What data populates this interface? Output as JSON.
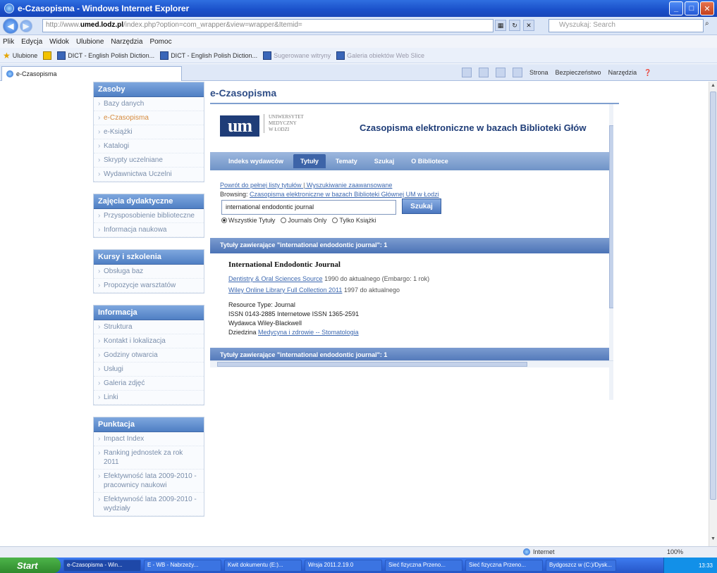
{
  "window": {
    "title": "e-Czasopisma - Windows Internet Explorer"
  },
  "address": {
    "url_prefix": "http://www.",
    "url_domain": "umed.lodz.pl",
    "url_rest": "/index.php?option=com_wrapper&view=wrapper&Itemid=",
    "search_placeholder": "Wyszukaj: Search"
  },
  "menu": [
    "Plik",
    "Edycja",
    "Widok",
    "Ulubione",
    "Narzędzia",
    "Pomoc"
  ],
  "favorites": {
    "label": "Ulubione",
    "items": [
      "DICT - English Polish Diction...",
      "DICT - English Polish Diction...",
      "Sugerowane witryny",
      "Galeria obiektów Web Slice"
    ]
  },
  "tab": {
    "label": "e-Czasopisma"
  },
  "commands": [
    "Strona",
    "Bezpieczeństwo",
    "Narzędzia"
  ],
  "sidebar": {
    "boxes": [
      {
        "title": "Zasoby",
        "items": [
          {
            "label": "Bazy danych",
            "active": false
          },
          {
            "label": "e-Czasopisma",
            "active": true
          },
          {
            "label": "e-Książki",
            "active": false
          },
          {
            "label": "Katalogi",
            "active": false
          },
          {
            "label": "Skrypty uczelniane",
            "active": false
          },
          {
            "label": "Wydawnictwa Uczelni",
            "active": false
          }
        ]
      },
      {
        "title": "Zajęcia dydaktyczne",
        "items": [
          {
            "label": "Przysposobienie biblioteczne",
            "active": false
          },
          {
            "label": "Informacja naukowa",
            "active": false
          }
        ]
      },
      {
        "title": "Kursy i szkolenia",
        "items": [
          {
            "label": "Obsługa baz",
            "active": false
          },
          {
            "label": "Propozycje warsztatów",
            "active": false
          }
        ]
      },
      {
        "title": "Informacja",
        "items": [
          {
            "label": "Struktura",
            "active": false
          },
          {
            "label": "Kontakt i lokalizacja",
            "active": false
          },
          {
            "label": "Godziny otwarcia",
            "active": false
          },
          {
            "label": "Usługi",
            "active": false
          },
          {
            "label": "Galeria zdjęć",
            "active": false
          },
          {
            "label": "Linki",
            "active": false
          }
        ]
      },
      {
        "title": "Punktacja",
        "items": [
          {
            "label": "Impact Index",
            "active": false
          },
          {
            "label": "Ranking jednostek za rok 2011",
            "active": false
          },
          {
            "label": "Efektywność lata 2009-2010 - pracownicy naukowi",
            "active": false
          },
          {
            "label": "Efektywność lata 2009-2010 - wydziały",
            "active": false
          }
        ]
      }
    ]
  },
  "main": {
    "page_title": "e-Czasopisma",
    "um_logo": "um",
    "um_text": [
      "UNIWERSYTET",
      "MEDYCZNY",
      "W ŁODZI"
    ],
    "banner_title": "Czasopisma elektroniczne w bazach Biblioteki Głów",
    "tabs": [
      {
        "label": "Indeks wydawców",
        "on": false
      },
      {
        "label": "Tytuły",
        "on": true
      },
      {
        "label": "Tematy",
        "on": false
      },
      {
        "label": "Szukaj",
        "on": false
      },
      {
        "label": "O Bibliotece",
        "on": false
      }
    ],
    "link1": "Powrót do pełnej listy tytułów",
    "link2": "Wyszukiwanie zaawansowane",
    "browsing_prefix": "Browsing:",
    "browsing_text": "Czasopisma elektroniczne w bazach Biblioteki Głównej UM w Łodzi",
    "search_value": "international endodontic journal",
    "search_button": "Szukaj",
    "radios": [
      {
        "label": "Wszystkie Tytuły",
        "on": true
      },
      {
        "label": "Journals Only",
        "on": false
      },
      {
        "label": "Tylko Książki",
        "on": false
      }
    ],
    "result_header": "Tytuły zawierające \"international endodontic journal\": 1",
    "journal_title": "International Endodontic Journal",
    "providers": [
      {
        "name": "Dentistry & Oral Sciences Source",
        "coverage": "1990 do aktualnego (Embargo: 1 rok)"
      },
      {
        "name": "Wiley Online Library Full Collection 2011",
        "coverage": "1997 do aktualnego"
      }
    ],
    "resource_type": "Resource Type: Journal",
    "issn": "ISSN 0143-2885 Internetowe ISSN 1365-2591",
    "publisher": "Wydawca Wiley-Blackwell",
    "subject_prefix": "Dziedzina",
    "subject": "Medycyna i zdrowie -- Stomatologia",
    "result_footer": "Tytuły zawierające \"international endodontic journal\": 1"
  },
  "status": {
    "zone": "Internet",
    "zoom": "100%"
  },
  "taskbar": {
    "start": "Start",
    "tasks": [
      "e-Czasopisma - Win...",
      "E - WB - Nabrzeży...",
      "Kwit dokumentu (E:)...",
      "Wrsja 2011.2.19.0",
      "Sieć fizyczna Przeno...",
      "Sieć fizyczna Przeno...",
      "Bydgoszcz w (C:)/Dysk..."
    ],
    "clock": "13:33"
  }
}
